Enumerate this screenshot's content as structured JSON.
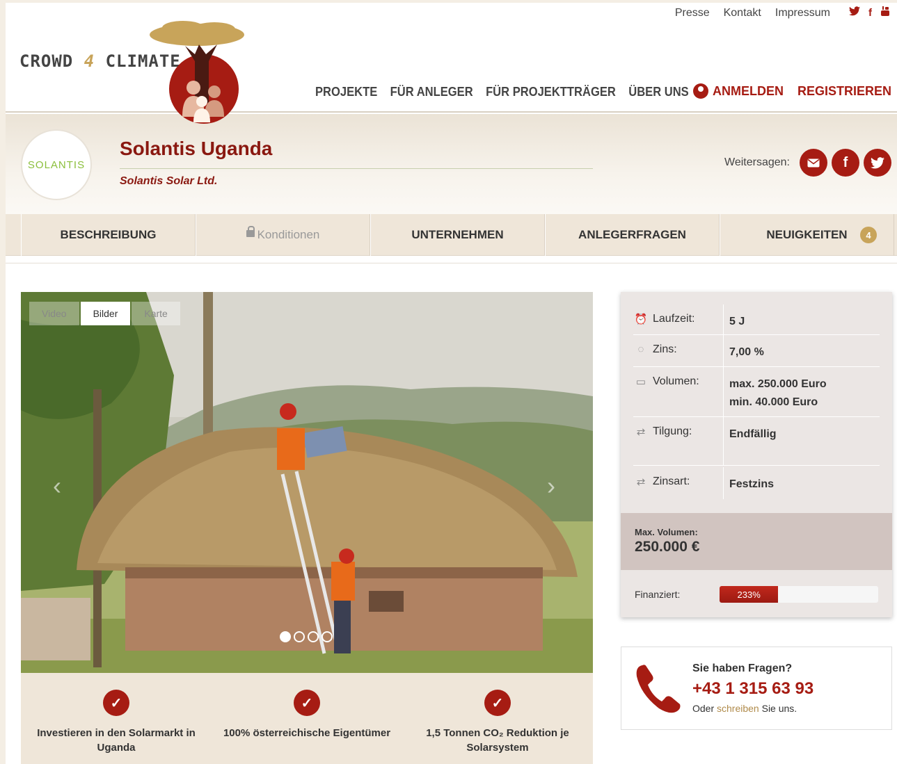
{
  "colors": {
    "brand_red": "#a61c13",
    "gold": "#c8a45a",
    "beige": "#efe6d9"
  },
  "header": {
    "top_links": [
      "Presse",
      "Kontakt",
      "Impressum"
    ],
    "social_icons": [
      "twitter-icon",
      "facebook-icon",
      "youtube-icon"
    ],
    "logo": {
      "part1": "CROWD",
      "part2": "4",
      "part3": "CLIMATE"
    },
    "nav": [
      "PROJEKTE",
      "FÜR ANLEGER",
      "FÜR PROJEKTTRÄGER",
      "ÜBER UNS"
    ],
    "login": "ANMELDEN",
    "register": "REGISTRIEREN"
  },
  "project": {
    "logo_text": "SOLANTIS",
    "title": "Solantis Uganda",
    "company": "Solantis Solar Ltd.",
    "share_label": "Weitersagen:",
    "share_icons": [
      "mail-icon",
      "facebook-icon",
      "twitter-icon"
    ]
  },
  "tabs": [
    {
      "label": "BESCHREIBUNG"
    },
    {
      "label": "Konditionen",
      "locked": true
    },
    {
      "label": "UNTERNEHMEN"
    },
    {
      "label": "ANLEGERFRAGEN"
    },
    {
      "label": "NEUIGKEITEN",
      "badge": "4"
    }
  ],
  "media": {
    "tabs": [
      "Video",
      "Bilder",
      "Karte"
    ],
    "active_tab": "Bilder",
    "slide_count": 4,
    "active_slide": 1
  },
  "features": [
    "Investieren in den Solarmarkt in Uganda",
    "100% österreichische Eigentümer",
    "1,5 Tonnen CO₂ Reduktion je Solarsystem"
  ],
  "info": {
    "rows": [
      {
        "label": "Laufzeit:",
        "value": "5 J",
        "icon": "alarm-clock-icon"
      },
      {
        "label": "Zins:",
        "value": "7,00 %",
        "icon": "piggy-bank-icon"
      },
      {
        "label": "Volumen:",
        "value": "max. 250.000 Euro",
        "value2": "min. 40.000 Euro",
        "icon": "banknote-icon"
      },
      {
        "label": "Tilgung:",
        "value": "Endfällig",
        "icon": "repeat-icon"
      },
      {
        "label": "Zinsart:",
        "value": "Festzins",
        "icon": "repeat-icon"
      }
    ],
    "max_volume_label": "Max. Volumen:",
    "max_volume_value": "250.000 €",
    "funded_label": "Finanziert:",
    "funded_percent": "233%",
    "funded_bar_fraction": 0.37
  },
  "contact": {
    "question": "Sie haben Fragen?",
    "phone": "+43 1 315 63 93",
    "line_pre": "Oder",
    "line_link": "schreiben",
    "line_post": "Sie uns."
  }
}
